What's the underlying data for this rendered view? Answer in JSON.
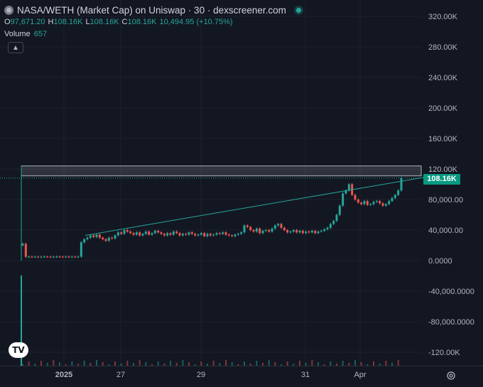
{
  "header": {
    "title": "NASA/WETH (Market Cap) on Uniswap · 30 · dexscreener.com",
    "ohlc": [
      {
        "key": "O",
        "value": "97,671.20"
      },
      {
        "key": "H",
        "value": "108.16K"
      },
      {
        "key": "L",
        "value": "108.16K"
      },
      {
        "key": "C",
        "value": "108.16K"
      }
    ],
    "change": "10,494.95 (+10.75%)",
    "volume_label": "Volume",
    "volume_value": "657",
    "collapse_icon": "chevron-up-icon"
  },
  "price_badge": "108.16K",
  "colors": {
    "up": "#26a69a",
    "down": "#ef5350",
    "background": "#131722",
    "trendline": "#26a69a",
    "badge": "#089981"
  },
  "chart_data": {
    "type": "candlestick",
    "y_ticks": [
      "320.00K",
      "280.00K",
      "240.00K",
      "200.00K",
      "160.00K",
      "120.00K",
      "80,000.00",
      "40,000.00",
      "0.0000",
      "-40,000.0000",
      "-80,000.0000",
      "-120.00K"
    ],
    "y_tick_values": [
      320000,
      280000,
      240000,
      200000,
      160000,
      120000,
      80000,
      40000,
      0,
      -40000,
      -80000,
      -120000
    ],
    "x_ticks": [
      "2025",
      "27",
      "29",
      "31",
      "Apr"
    ],
    "ylim": [
      -133000,
      345000
    ],
    "last_price": 108160,
    "close_series": [
      22000,
      5000,
      5200,
      5000,
      5100,
      4900,
      5000,
      5200,
      5100,
      5000,
      5000,
      5300,
      5100,
      5000,
      5200,
      5000,
      5100,
      5000,
      5200,
      24000,
      28000,
      30000,
      33000,
      31000,
      34000,
      30000,
      28000,
      26000,
      30000,
      29000,
      33000,
      37000,
      35000,
      40000,
      38000,
      36000,
      34000,
      37000,
      33000,
      35000,
      38000,
      34000,
      36000,
      39000,
      37000,
      35000,
      33000,
      36000,
      34000,
      38000,
      36000,
      33000,
      35000,
      34000,
      37000,
      35000,
      33000,
      34000,
      36000,
      32000,
      35000,
      33000,
      34000,
      36000,
      35000,
      37000,
      34000,
      33000,
      32000,
      34000,
      35000,
      37000,
      46000,
      44000,
      40000,
      38000,
      42000,
      36000,
      39000,
      40000,
      38000,
      42000,
      46000,
      48000,
      43000,
      40000,
      37000,
      38000,
      40000,
      37000,
      39000,
      36000,
      38000,
      37000,
      39000,
      36000,
      38000,
      39000,
      41000,
      43000,
      48000,
      52000,
      60000,
      72000,
      88000,
      92000,
      100000,
      86000,
      80000,
      76000,
      74000,
      78000,
      73000,
      74000,
      77000,
      78000,
      75000,
      72000,
      74000,
      78000,
      82000,
      86000,
      92000,
      108000
    ],
    "volume_spike": 657,
    "resistance_zone": [
      111000,
      124000
    ],
    "trendline": [
      [
        120,
        33000
      ],
      [
        567,
        108160
      ]
    ]
  }
}
